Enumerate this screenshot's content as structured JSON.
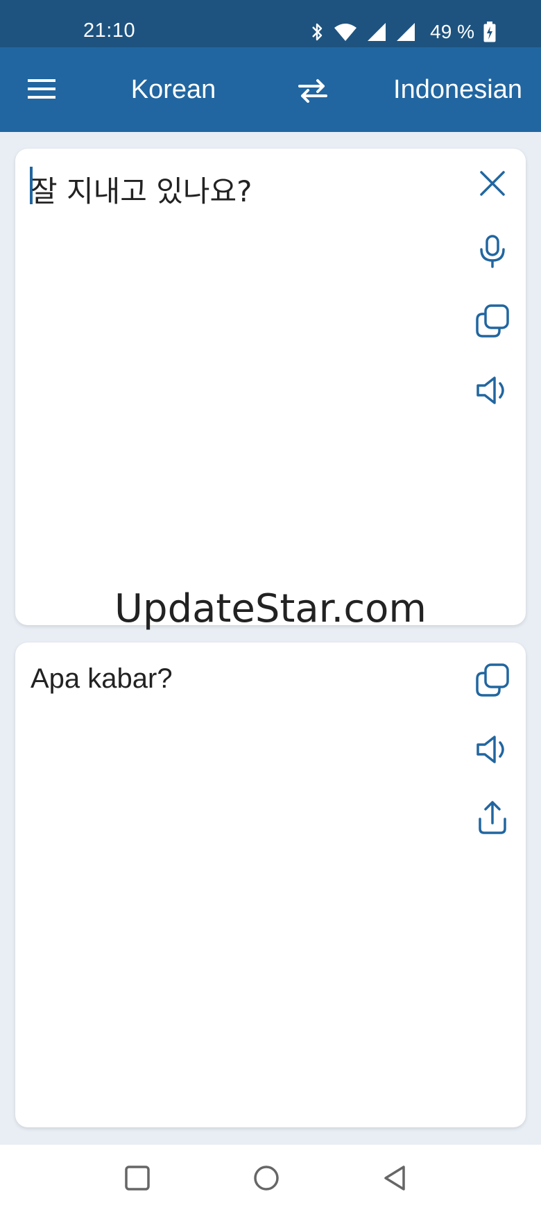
{
  "status_bar": {
    "time": "21:10",
    "battery": "49 %",
    "icons": [
      "bluetooth-icon",
      "wifi-icon",
      "signal-icon",
      "signal-icon",
      "battery-charging-icon"
    ]
  },
  "app_bar": {
    "source_language": "Korean",
    "target_language": "Indonesian",
    "menu_icon": "menu-icon",
    "swap_icon": "swap-arrows-icon"
  },
  "source_panel": {
    "text": "잘 지내고 있나요?",
    "actions": [
      "close-icon",
      "microphone-icon",
      "copy-icon",
      "speaker-icon"
    ]
  },
  "target_panel": {
    "text": "Apa kabar?",
    "actions": [
      "copy-icon",
      "speaker-icon",
      "share-icon"
    ]
  },
  "watermark": "UpdateStar.com",
  "nav_bar": {
    "buttons": [
      "recents-square-icon",
      "home-circle-icon",
      "back-triangle-icon"
    ]
  },
  "colors": {
    "status_bar": "#1e537f",
    "app_bar": "#2166a0",
    "accent": "#2166a0",
    "background": "#e9eef5"
  }
}
